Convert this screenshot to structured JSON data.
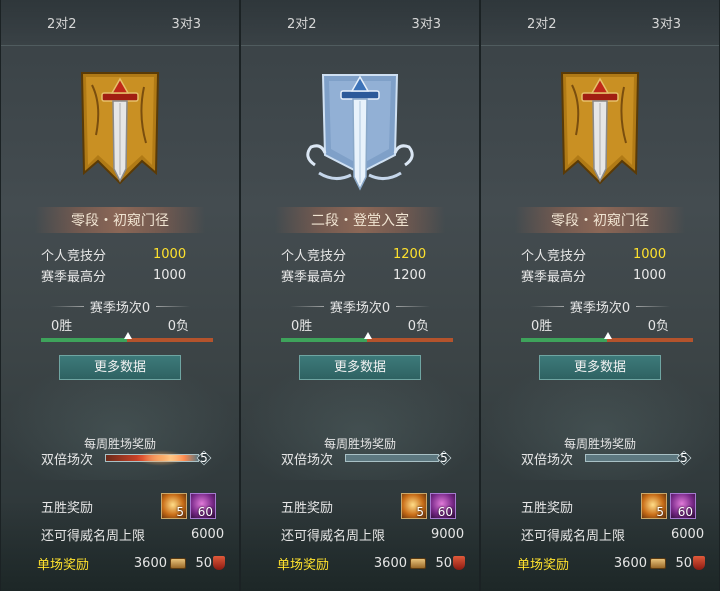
{
  "panels": [
    {
      "tabs": [
        "2对2",
        "3对3"
      ],
      "emblem": "gold-sword-banner-icon",
      "rank_title": "零段・初窥门径",
      "personal_score_label": "个人竞技分",
      "personal_score": "1000",
      "season_high_label": "赛季最高分",
      "season_high": "1000",
      "season_matches": "赛季场次0",
      "wins": "0胜",
      "losses": "0负",
      "win_fraction": 0.5,
      "more_data": "更多数据",
      "weekly_title": "每周胜场奖励",
      "double_label": "双倍场次",
      "double_count": "5",
      "double_fill": 1.0,
      "five_win_label": "五胜奖励",
      "item1_count": "5",
      "item2_count": "60",
      "cap_label": "还可得威名周上限",
      "cap_value": "6000",
      "single_label": "单场奖励",
      "single_coin": "3600",
      "single_shield": "50",
      "score_color": "#ffe22d"
    },
    {
      "tabs": [
        "2对2",
        "3对3"
      ],
      "emblem": "silver-sword-banner-icon",
      "rank_title": "二段・登堂入室",
      "personal_score_label": "个人竞技分",
      "personal_score": "1200",
      "season_high_label": "赛季最高分",
      "season_high": "1200",
      "season_matches": "赛季场次0",
      "wins": "0胜",
      "losses": "0负",
      "win_fraction": 0.5,
      "more_data": "更多数据",
      "weekly_title": "每周胜场奖励",
      "double_label": "双倍场次",
      "double_count": "5",
      "double_fill": 0.0,
      "five_win_label": "五胜奖励",
      "item1_count": "5",
      "item2_count": "60",
      "cap_label": "还可得威名周上限",
      "cap_value": "9000",
      "single_label": "单场奖励",
      "single_coin": "3600",
      "single_shield": "50",
      "score_color": "#ffe22d"
    },
    {
      "tabs": [
        "2对2",
        "3对3"
      ],
      "emblem": "gold-sword-banner-icon",
      "rank_title": "零段・初窥门径",
      "personal_score_label": "个人竞技分",
      "personal_score": "1000",
      "season_high_label": "赛季最高分",
      "season_high": "1000",
      "season_matches": "赛季场次0",
      "wins": "0胜",
      "losses": "0负",
      "win_fraction": 0.5,
      "more_data": "更多数据",
      "weekly_title": "每周胜场奖励",
      "double_label": "双倍场次",
      "double_count": "5",
      "double_fill": 0.0,
      "five_win_label": "五胜奖励",
      "item1_count": "5",
      "item2_count": "60",
      "cap_label": "还可得威名周上限",
      "cap_value": "6000",
      "single_label": "单场奖励",
      "single_coin": "3600",
      "single_shield": "50",
      "score_color": "#ffe22d"
    }
  ]
}
